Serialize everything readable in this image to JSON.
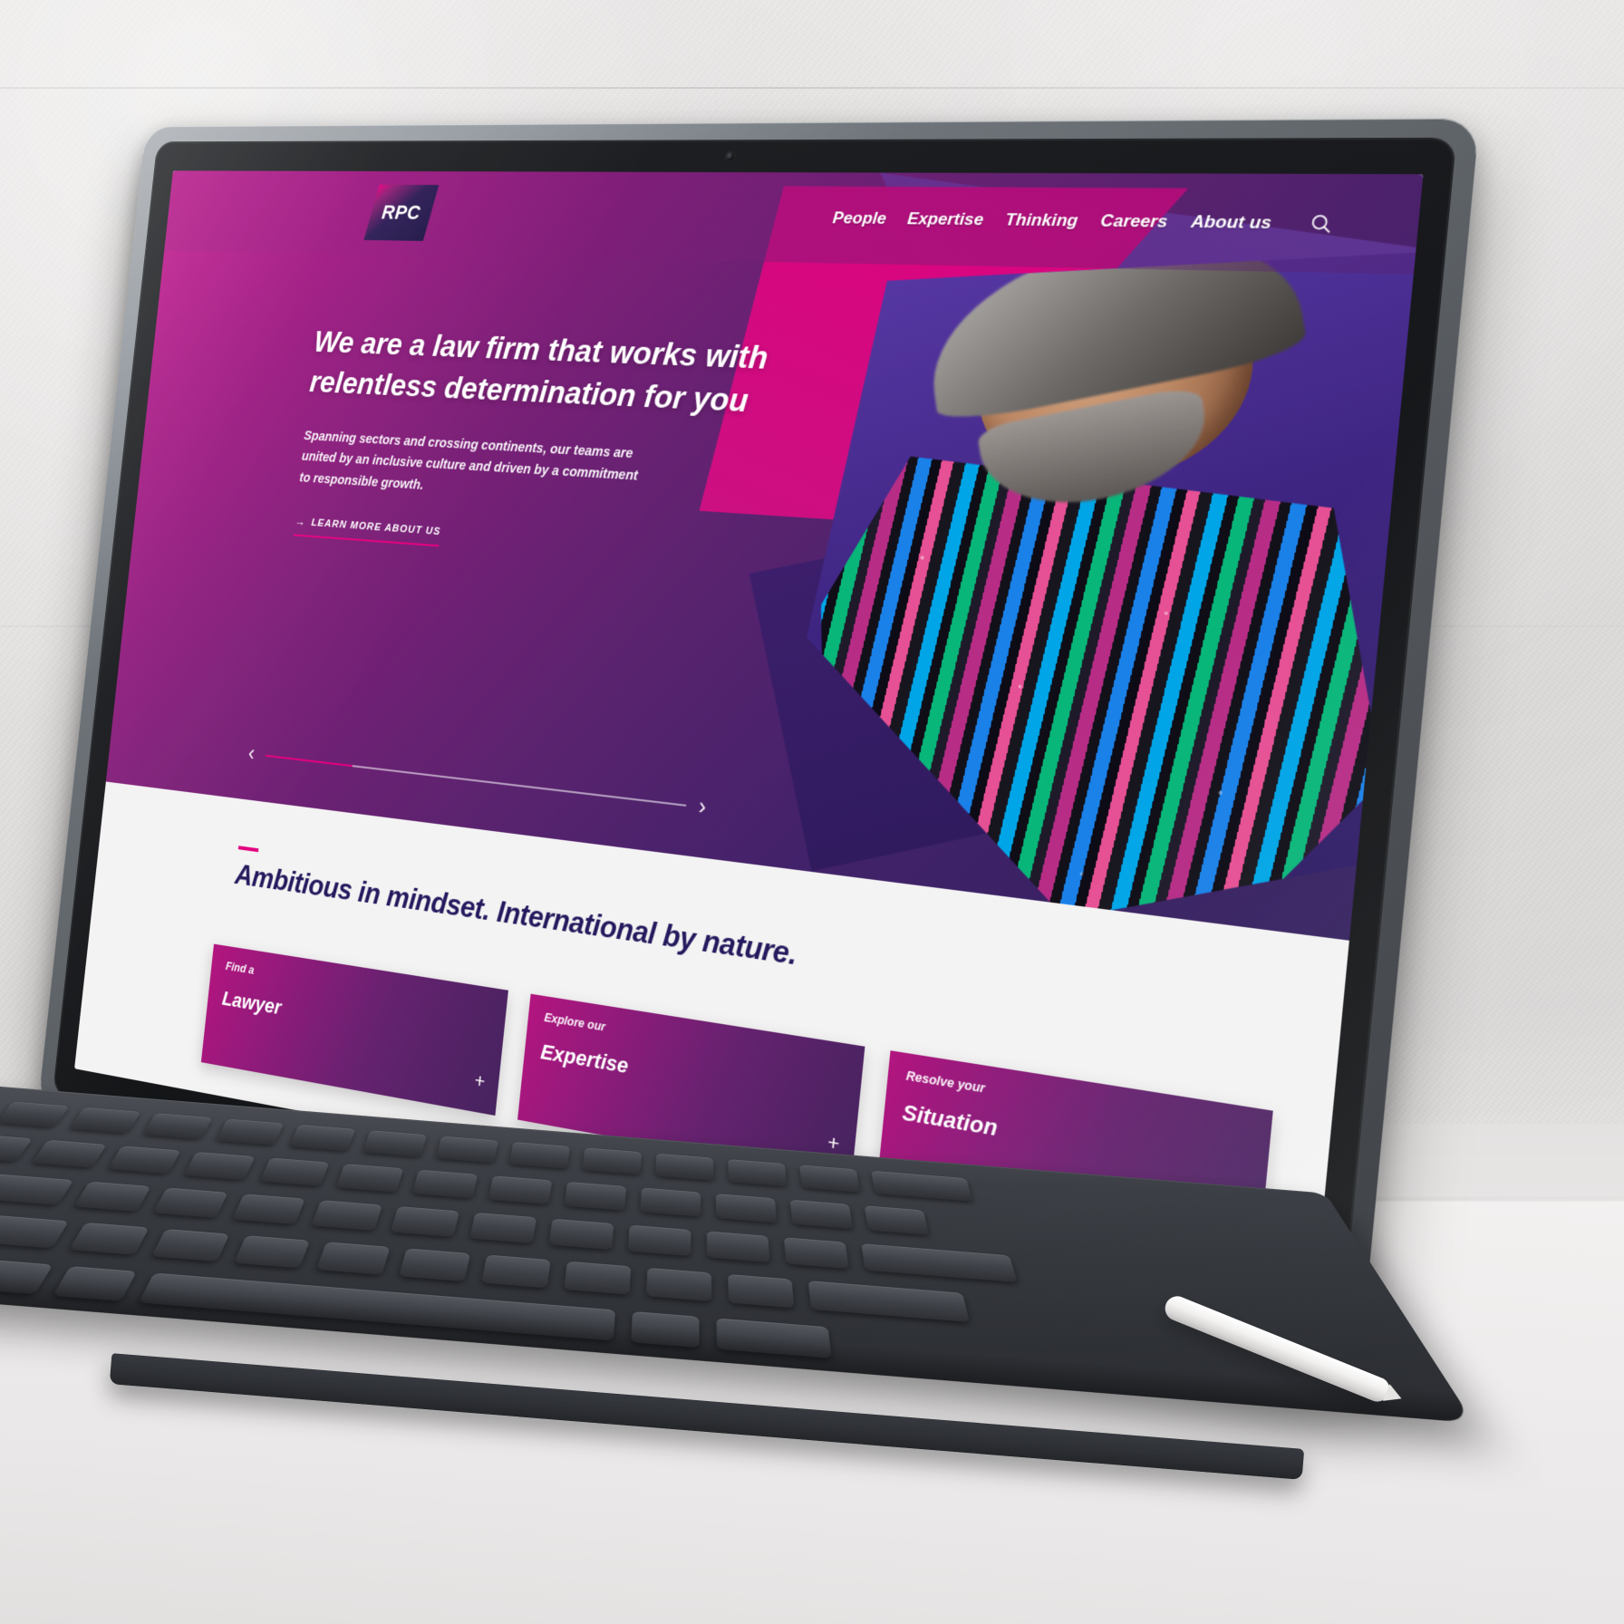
{
  "header": {
    "logo_text": "RPC",
    "nav_items": [
      {
        "label": "People"
      },
      {
        "label": "Expertise"
      },
      {
        "label": "Thinking"
      },
      {
        "label": "Careers"
      },
      {
        "label": "About us"
      }
    ],
    "search_icon": "search-icon"
  },
  "hero": {
    "title": "We are a law firm that works with relentless determination for you",
    "subtitle": "Spanning sectors and crossing continents, our teams are united by an inclusive culture and driven by a commitment to responsible growth.",
    "cta_label": "LEARN MORE ABOUT US",
    "cta_arrow": "→",
    "carousel": {
      "prev_icon": "‹",
      "next_icon": "›",
      "progress_percent": 22
    }
  },
  "lower": {
    "heading": "Ambitious in mindset. International by nature.",
    "cards": [
      {
        "eyebrow": "Find a",
        "title": "Lawyer",
        "plus": "+"
      },
      {
        "eyebrow": "Explore our",
        "title": "Expertise",
        "plus": "+"
      },
      {
        "eyebrow": "Resolve your",
        "title": "Situation",
        "plus": "+"
      }
    ]
  },
  "colors": {
    "brand_magenta": "#e3007e",
    "brand_purple": "#7d1f78",
    "brand_navy": "#241a5e",
    "hero_gradient_start": "#c3148b",
    "hero_gradient_end": "#33205e",
    "lower_bg": "#f4f3f3"
  }
}
